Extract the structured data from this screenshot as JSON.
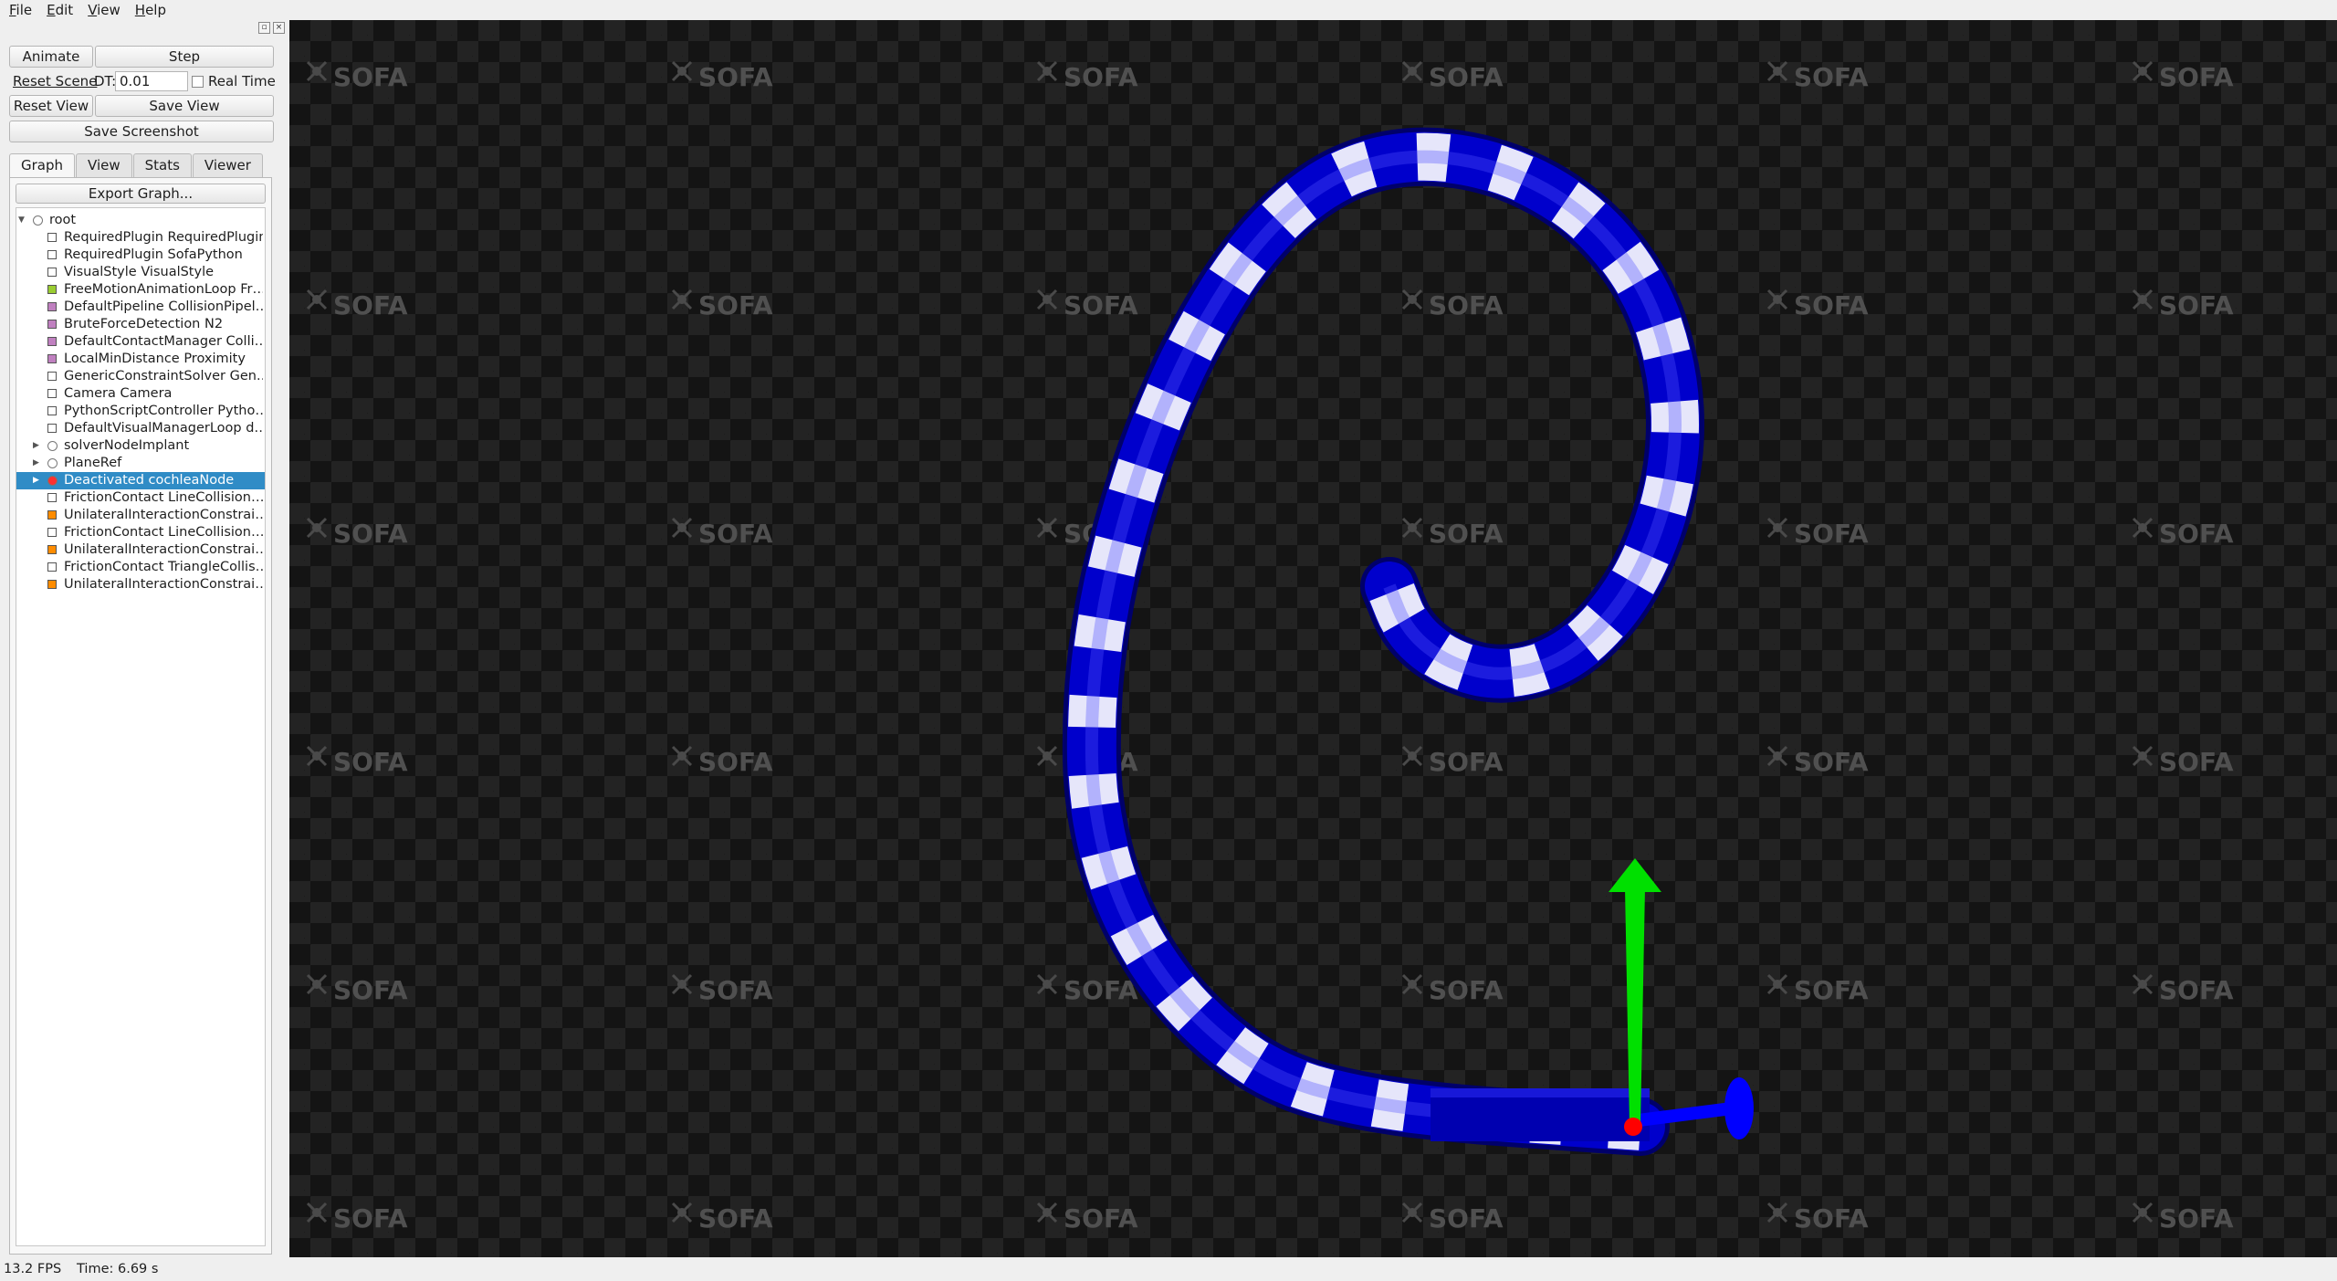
{
  "menu": [
    {
      "label": "File",
      "accel": "F",
      "rest": "ile"
    },
    {
      "label": "Edit",
      "accel": "E",
      "rest": "dit"
    },
    {
      "label": "View",
      "accel": "V",
      "rest": "iew"
    },
    {
      "label": "Help",
      "accel": "H",
      "rest": "elp"
    }
  ],
  "controls": {
    "animate": "Animate",
    "step": "Step",
    "reset_scene": "Reset Scene",
    "dt_label": "DT:",
    "dt_value": "0.01",
    "real_time": "Real Time",
    "reset_view": "Reset View",
    "save_view": "Save View",
    "save_screenshot": "Save Screenshot"
  },
  "tabs": [
    "Graph",
    "View",
    "Stats",
    "Viewer"
  ],
  "active_tab": "Graph",
  "graph": {
    "export_button": "Export Graph...",
    "tree": [
      {
        "text": "root",
        "level": 0,
        "icon": "node",
        "color": "#ffffff",
        "expanded": true
      },
      {
        "text": "RequiredPlugin RequiredPlugin",
        "level": 1,
        "icon": "square",
        "color": "#ffffff"
      },
      {
        "text": "RequiredPlugin SofaPython",
        "level": 1,
        "icon": "square",
        "color": "#ffffff"
      },
      {
        "text": "VisualStyle VisualStyle",
        "level": 1,
        "icon": "square",
        "color": "#ffffff"
      },
      {
        "text": "FreeMotionAnimationLoop Fr…",
        "level": 1,
        "icon": "square",
        "color": "#9acd32"
      },
      {
        "text": "DefaultPipeline CollisionPipel…",
        "level": 1,
        "icon": "square",
        "color": "#c080c0"
      },
      {
        "text": "BruteForceDetection N2",
        "level": 1,
        "icon": "square",
        "color": "#c080c0"
      },
      {
        "text": "DefaultContactManager Colli…",
        "level": 1,
        "icon": "square",
        "color": "#c080c0"
      },
      {
        "text": "LocalMinDistance Proximity",
        "level": 1,
        "icon": "square",
        "color": "#c080c0"
      },
      {
        "text": "GenericConstraintSolver Gen…",
        "level": 1,
        "icon": "square",
        "color": "#ffffff"
      },
      {
        "text": "Camera Camera",
        "level": 1,
        "icon": "square",
        "color": "#ffffff"
      },
      {
        "text": "PythonScriptController Pytho…",
        "level": 1,
        "icon": "square",
        "color": "#ffffff"
      },
      {
        "text": "DefaultVisualManagerLoop d…",
        "level": 1,
        "icon": "square",
        "color": "#ffffff"
      },
      {
        "text": "solverNodeImplant",
        "level": 1,
        "icon": "node",
        "color": "#ffffff",
        "collapsed": true
      },
      {
        "text": "PlaneRef",
        "level": 1,
        "icon": "node",
        "color": "#ffffff",
        "collapsed": true
      },
      {
        "text": "Deactivated cochleaNode",
        "level": 1,
        "icon": "node",
        "color": "#ff3030",
        "collapsed": true,
        "selected": true
      },
      {
        "text": "FrictionContact LineCollision…",
        "level": 1,
        "icon": "square",
        "color": "#ffffff"
      },
      {
        "text": "UnilateralInteractionConstrai…",
        "level": 1,
        "icon": "square",
        "color": "#ff8c00"
      },
      {
        "text": "FrictionContact LineCollision…",
        "level": 1,
        "icon": "square",
        "color": "#ffffff"
      },
      {
        "text": "UnilateralInteractionConstrai…",
        "level": 1,
        "icon": "square",
        "color": "#ff8c00"
      },
      {
        "text": "FrictionContact TriangleCollis…",
        "level": 1,
        "icon": "square",
        "color": "#ffffff"
      },
      {
        "text": "UnilateralInteractionConstrai…",
        "level": 1,
        "icon": "square",
        "color": "#ff8c00"
      }
    ]
  },
  "viewport": {
    "watermark": "SOFA",
    "tube_color": "#0000cc",
    "axis_colors": {
      "y": "#00e000",
      "x": "#0000ff",
      "z": "#ff0000"
    }
  },
  "status": {
    "fps": "13.2 FPS",
    "time": "Time: 6.69 s"
  }
}
